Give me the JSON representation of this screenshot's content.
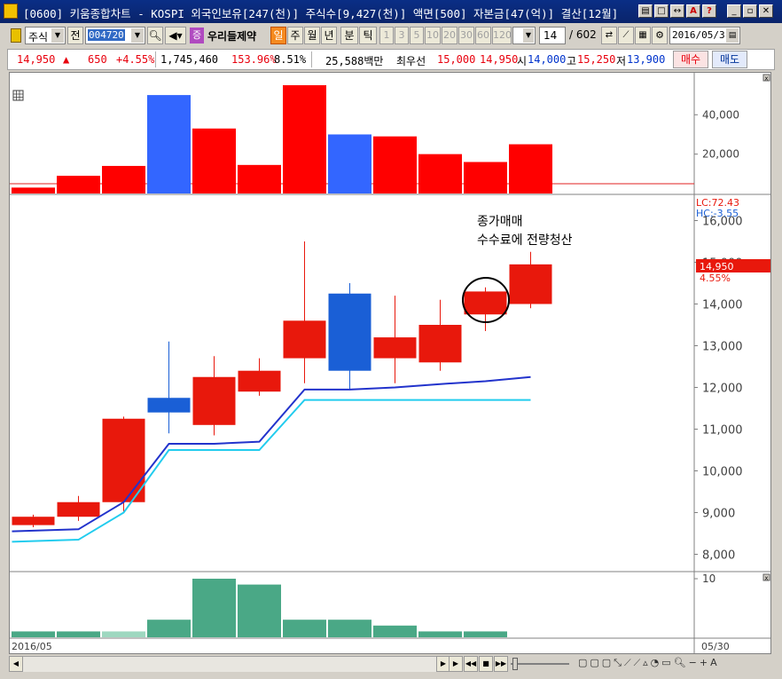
{
  "window": {
    "title": "[0600] 키움종합차트 - KOSPI 외국인보유[247(천)] 주식수[9,427(천)] 액면[500] 자본금[47(억)] 결산[12월]",
    "title_suffix": "4 가"
  },
  "toolbar": {
    "market_type": "주식",
    "all_label": "전",
    "stock_code": "004720",
    "badge_jeung": "증",
    "stock_name": "우리들제약",
    "period_day": "일",
    "period_week": "주",
    "period_month": "월",
    "period_year": "년",
    "period_minute": "분",
    "period_tick": "틱",
    "minute_options": [
      "1",
      "3",
      "5",
      "10",
      "20",
      "30",
      "60",
      "120"
    ],
    "count_value": "14",
    "count_total": "/ 602",
    "date_value": "2016/05/3"
  },
  "quote": {
    "price": "14,950",
    "change": "650",
    "change_pct": "+4.55%",
    "volume": "1,745,460",
    "volume_ratio": "153.96%",
    "turnover": "8.51%",
    "amount": "25,588백만",
    "best_label": "최우선",
    "ask": "15,000",
    "bid": "14,950",
    "open_label": "시",
    "open": "14,000",
    "high_label": "고",
    "high": "15,250",
    "low_label": "저",
    "low": "13,900",
    "buy_label": "매수",
    "sell_label": "매도"
  },
  "chart": {
    "lc_label": "LC:72.43",
    "hc_label": "HC:-3.55",
    "price_marker": "14,950",
    "price_marker_pct": "4.55%",
    "annotation_line1": "종가매매",
    "annotation_line2": "수수료에 전량청산",
    "date_left": "2016/05",
    "date_right": "05/30",
    "colors": {
      "up": "#e8180c",
      "down": "#1a5fd6",
      "volume_up": "#ff0000",
      "volume_down": "#3366ff",
      "line_dark": "#2233cc",
      "line_light": "#22ccee",
      "osc": "#4aa886"
    }
  },
  "chart_data": [
    {
      "type": "bar",
      "title": "",
      "yticks": [
        "20,000",
        "40,000"
      ],
      "ylim": [
        0,
        55000
      ],
      "values": [
        3000,
        9000,
        14000,
        50000,
        33000,
        14500,
        55000,
        30000,
        29000,
        20000,
        16000,
        25000
      ],
      "directions": [
        "up",
        "up",
        "up",
        "down",
        "up",
        "up",
        "up",
        "down",
        "up",
        "up",
        "up",
        "up"
      ]
    },
    {
      "type": "candlestick",
      "yticks": [
        "8,000",
        "9,000",
        "10,000",
        "11,000",
        "12,000",
        "13,000",
        "14,000",
        "15,000",
        "16,000"
      ],
      "ylim": [
        7500,
        16500
      ],
      "candles": [
        {
          "open": 8700,
          "close": 8900,
          "high": 8950,
          "low": 8650
        },
        {
          "open": 8900,
          "close": 9250,
          "high": 9400,
          "low": 8800
        },
        {
          "open": 9250,
          "close": 11250,
          "high": 11300,
          "low": 9000
        },
        {
          "open": 11750,
          "close": 11400,
          "high": 13100,
          "low": 10900
        },
        {
          "open": 11100,
          "close": 12250,
          "high": 12750,
          "low": 10850
        },
        {
          "open": 11900,
          "close": 12400,
          "high": 12700,
          "low": 11800
        },
        {
          "open": 12700,
          "close": 13600,
          "high": 15500,
          "low": 12100
        },
        {
          "open": 14250,
          "close": 12400,
          "high": 14500,
          "low": 11950
        },
        {
          "open": 12700,
          "close": 13200,
          "high": 14200,
          "low": 12100
        },
        {
          "open": 12600,
          "close": 13500,
          "high": 14100,
          "low": 12400
        },
        {
          "open": 13750,
          "close": 14300,
          "high": 14400,
          "low": 13350
        },
        {
          "open": 14000,
          "close": 14950,
          "high": 15250,
          "low": 13900
        }
      ],
      "line_dark": [
        8550,
        8600,
        9250,
        10650,
        10650,
        10700,
        11950,
        11950,
        12000,
        12080,
        12150,
        12250
      ],
      "line_light": [
        8300,
        8350,
        9000,
        10500,
        10500,
        10500,
        11700,
        11700,
        11700,
        11700,
        11700,
        11700
      ]
    },
    {
      "type": "bar",
      "yticks": [
        "10"
      ],
      "values": [
        1,
        1,
        1,
        3,
        10,
        9,
        3,
        3,
        2,
        1,
        1,
        0
      ]
    }
  ]
}
